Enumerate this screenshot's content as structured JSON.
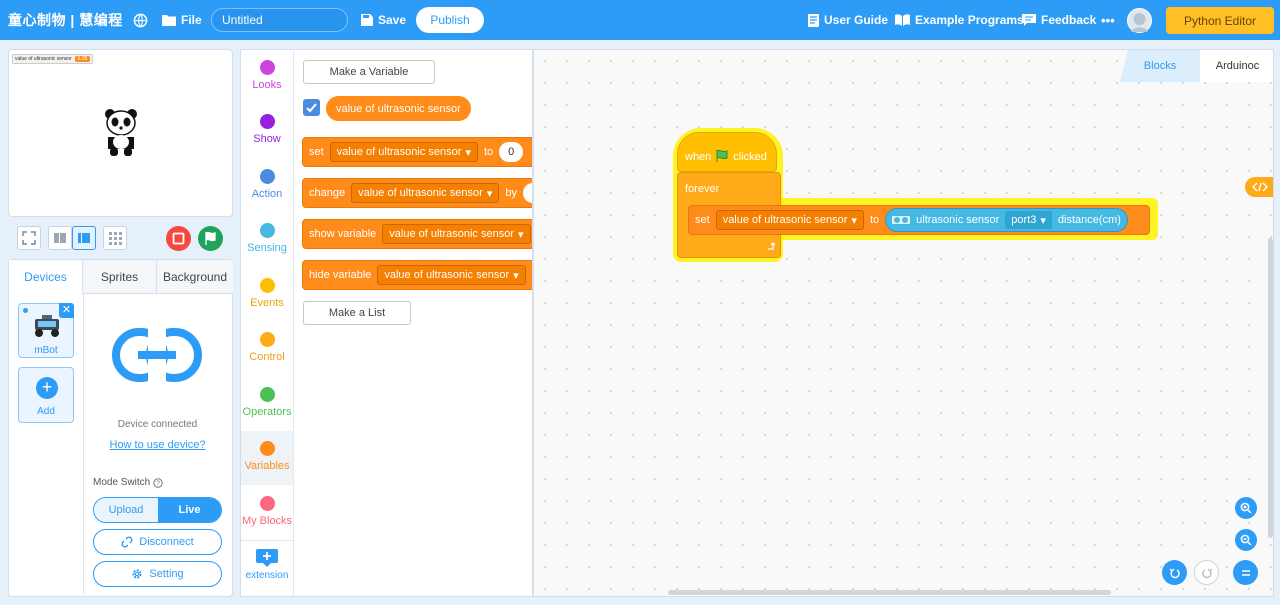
{
  "header": {
    "logo": "童心制物 | 慧编程",
    "file_label": "File",
    "title_value": "Untitled",
    "save_label": "Save",
    "publish_label": "Publish",
    "user_guide": "User Guide",
    "example_programs": "Example Programs",
    "feedback": "Feedback",
    "more": "•••",
    "python_editor": "Python Editor"
  },
  "stage": {
    "monitor_label": "value of ultrasonic sensor",
    "monitor_value": "6.36"
  },
  "tabs": [
    "Devices",
    "Sprites",
    "Background"
  ],
  "devices": {
    "device_name": "mBot",
    "add_label": "Add",
    "status": "Device connected",
    "help_link": "How to use device?",
    "mode_switch_label": "Mode Switch",
    "upload_label": "Upload",
    "live_label": "Live",
    "disconnect_label": "Disconnect",
    "setting_label": "Setting"
  },
  "categories": [
    {
      "label": "Looks",
      "color": "#cc44dd"
    },
    {
      "label": "Show",
      "color": "#9920e0"
    },
    {
      "label": "Action",
      "color": "#4a8de0"
    },
    {
      "label": "Sensing",
      "color": "#45b8e3"
    },
    {
      "label": "Events",
      "color": "#ffbf00"
    },
    {
      "label": "Control",
      "color": "#ffab19"
    },
    {
      "label": "Operators",
      "color": "#4cbf56"
    },
    {
      "label": "Variables",
      "color": "#ff8c1a"
    },
    {
      "label": "My Blocks",
      "color": "#ff6680"
    },
    {
      "label": "extension",
      "color": "#2d9cf6"
    }
  ],
  "palette": {
    "make_variable": "Make a Variable",
    "variable_name": "value of ultrasonic sensor",
    "set_label": "set",
    "to_label": "to",
    "set_value": "0",
    "change_label": "change",
    "by_label": "by",
    "show_variable": "show variable",
    "hide_variable": "hide variable",
    "make_list": "Make a List"
  },
  "workspace": {
    "tab_blocks": "Blocks",
    "tab_arduino": "Arduinoc",
    "when_label": "when",
    "clicked_label": "clicked",
    "forever_label": "forever",
    "set_label": "set",
    "to_label": "to",
    "sensor_label": "ultrasonic sensor",
    "port_label": "port3",
    "distance_label": "distance(cm)",
    "variable_name": "value of ultrasonic sensor"
  },
  "colors": {
    "brand": "#2d9cf6",
    "variables": "#ff8c1a",
    "events": "#ffbf00",
    "sensing": "#45b8e3"
  }
}
